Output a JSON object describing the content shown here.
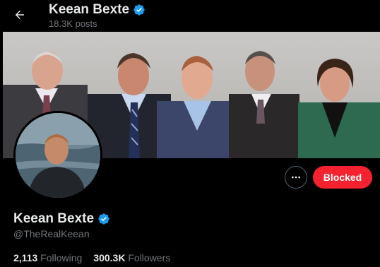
{
  "header": {
    "title": "Keean Bexte",
    "posts_count": "18.3K posts"
  },
  "profile": {
    "display_name": "Keean Bexte",
    "handle": "@TheRealKeean",
    "verified_icon": "verified-badge-icon",
    "following_count": "2,113",
    "following_label": "Following",
    "followers_count": "300.3K",
    "followers_label": "Followers"
  },
  "actions": {
    "blocked_label": "Blocked",
    "more_icon": "more-icon"
  },
  "colors": {
    "background": "#000000",
    "blocked_button": "#f4212e",
    "verified_badge": "#1d9bf0",
    "secondary_text": "#71767b",
    "primary_text": "#e7e9ea"
  }
}
